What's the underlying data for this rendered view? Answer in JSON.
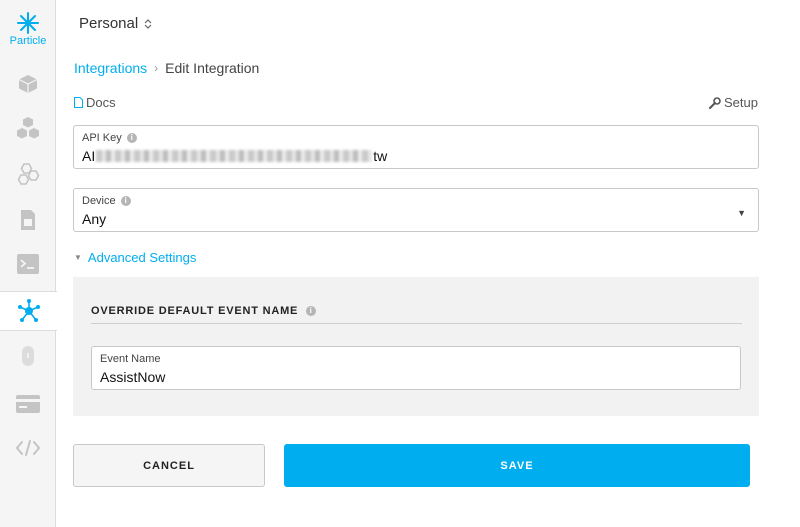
{
  "colors": {
    "accent": "#00aeef",
    "sidebar_bg": "#f5f5f5",
    "panel_bg": "#f2f2f2"
  },
  "sidebar": {
    "logo_text": "Particle",
    "items": [
      {
        "name": "devices",
        "icon": "cube-icon"
      },
      {
        "name": "products",
        "icon": "cubes-icon"
      },
      {
        "name": "mesh",
        "icon": "hexagons-icon"
      },
      {
        "name": "sim-cards",
        "icon": "sim-card-icon"
      },
      {
        "name": "console",
        "icon": "terminal-icon"
      },
      {
        "name": "integrations",
        "icon": "integrations-icon",
        "active": true
      },
      {
        "name": "authentication",
        "icon": "key-fob-icon"
      },
      {
        "name": "billing",
        "icon": "credit-card-icon"
      },
      {
        "name": "code",
        "icon": "code-icon"
      }
    ]
  },
  "header": {
    "org_name": "Personal",
    "org_chevron": "⌃⌄"
  },
  "breadcrumb": {
    "parent": "Integrations",
    "separator": "›",
    "current": "Edit Integration"
  },
  "links": {
    "docs": "Docs",
    "setup": "Setup"
  },
  "form": {
    "api_key": {
      "label": "API Key",
      "value_prefix": "AI",
      "value_suffix": "tw"
    },
    "device": {
      "label": "Device",
      "value": "Any"
    }
  },
  "advanced": {
    "toggle_label": "Advanced Settings",
    "section_title": "OVERRIDE DEFAULT EVENT NAME",
    "event_name": {
      "label": "Event Name",
      "value": "AssistNow"
    }
  },
  "buttons": {
    "cancel": "CANCEL",
    "save": "SAVE"
  }
}
